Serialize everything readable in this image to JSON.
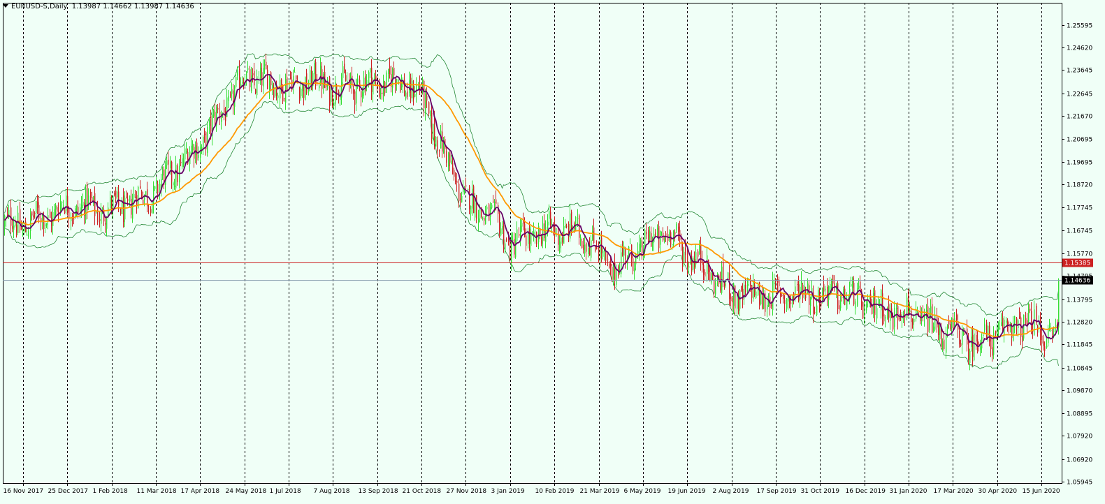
{
  "header": {
    "symbol": "EURUSD-S,Daily",
    "ohlc": "1.13987 1.14662 1.13987 1.14636"
  },
  "colors": {
    "background": "#f0fff7",
    "bull": "#33dd33",
    "bear": "#cc2222",
    "ma_fast": "#660066",
    "ma_slow": "#ff9900",
    "bands": "#228833",
    "hline_red": "#cc2222",
    "hline_gray": "#8aa0b0",
    "grid": "#000000"
  },
  "chart_data": {
    "type": "candlestick",
    "title": "EURUSD-S,Daily",
    "y_ticks": [
      "1.25595",
      "1.24620",
      "1.23645",
      "1.22645",
      "1.21670",
      "1.20695",
      "1.19695",
      "1.18720",
      "1.17745",
      "1.16745",
      "1.15770",
      "1.14795",
      "1.13795",
      "1.12820",
      "1.11845",
      "1.10845",
      "1.09870",
      "1.08895",
      "1.07920",
      "1.06920",
      "1.05945"
    ],
    "x_ticks": [
      "16 Nov 2017",
      "25 Dec 2017",
      "1 Feb 2018",
      "11 Mar 2018",
      "17 Apr 2018",
      "24 May 2018",
      "1 Jul 2018",
      "7 Aug 2018",
      "13 Sep 2018",
      "21 Oct 2018",
      "27 Nov 2018",
      "3 Jan 2019",
      "10 Feb 2019",
      "21 Mar 2019",
      "6 May 2019",
      "19 Jun 2019",
      "2 Aug 2019",
      "17 Sep 2019",
      "31 Oct 2019",
      "16 Dec 2019",
      "31 Jan 2020",
      "17 Mar 2020",
      "30 Apr 2020",
      "15 Jun 2020"
    ],
    "ylim": [
      1.05945,
      1.25595
    ],
    "horizontal_lines": [
      {
        "value": 1.15385,
        "label": "1.15385",
        "style": "red"
      },
      {
        "value": 1.14636,
        "label": "1.14636",
        "style": "gray"
      }
    ],
    "trend_path": [
      [
        0,
        1.17
      ],
      [
        1,
        1.178
      ],
      [
        2,
        1.176
      ],
      [
        3,
        1.185
      ],
      [
        4,
        1.205
      ],
      [
        5,
        1.233
      ],
      [
        6,
        1.23
      ],
      [
        6.5,
        1.232
      ],
      [
        7,
        1.229
      ],
      [
        8,
        1.231
      ],
      [
        8.5,
        1.232
      ],
      [
        9,
        1.225
      ],
      [
        9.5,
        1.2
      ],
      [
        10,
        1.18
      ],
      [
        10.5,
        1.175
      ],
      [
        11,
        1.162
      ],
      [
        11.5,
        1.165
      ],
      [
        12,
        1.168
      ],
      [
        12.7,
        1.166
      ],
      [
        13.3,
        1.15
      ],
      [
        13.6,
        1.156
      ],
      [
        14,
        1.16
      ],
      [
        14.5,
        1.167
      ],
      [
        15,
        1.158
      ],
      [
        15.5,
        1.15
      ],
      [
        16,
        1.14
      ],
      [
        16.5,
        1.14
      ],
      [
        17,
        1.139
      ],
      [
        17.5,
        1.141
      ],
      [
        18,
        1.14
      ],
      [
        18.5,
        1.14
      ],
      [
        19,
        1.136
      ],
      [
        19.5,
        1.133
      ],
      [
        20,
        1.132
      ],
      [
        20.5,
        1.126
      ],
      [
        21,
        1.123
      ],
      [
        21.5,
        1.119
      ],
      [
        22,
        1.123
      ],
      [
        22.5,
        1.128
      ],
      [
        23,
        1.124
      ],
      [
        23.5,
        1.122
      ],
      [
        24,
        1.118
      ],
      [
        24.5,
        1.108
      ],
      [
        25,
        1.105
      ],
      [
        25.5,
        1.099
      ],
      [
        26,
        1.102
      ],
      [
        26.5,
        1.108
      ],
      [
        27,
        1.105
      ],
      [
        27.5,
        1.104
      ],
      [
        28,
        1.109
      ],
      [
        28.5,
        1.111
      ],
      [
        29,
        1.108
      ],
      [
        29.5,
        1.1
      ],
      [
        30,
        1.09
      ],
      [
        30.5,
        1.106
      ],
      [
        31,
        1.096
      ],
      [
        31.5,
        1.086
      ],
      [
        32,
        1.087
      ],
      [
        32.5,
        1.083
      ],
      [
        33,
        1.087
      ],
      [
        33.5,
        1.115
      ],
      [
        34,
        1.12
      ],
      [
        34.5,
        1.123
      ],
      [
        35,
        1.13
      ]
    ],
    "candles_note": "daily candles from 16 Nov 2017 to Jul 2020, last close 1.14636",
    "grid": true
  }
}
